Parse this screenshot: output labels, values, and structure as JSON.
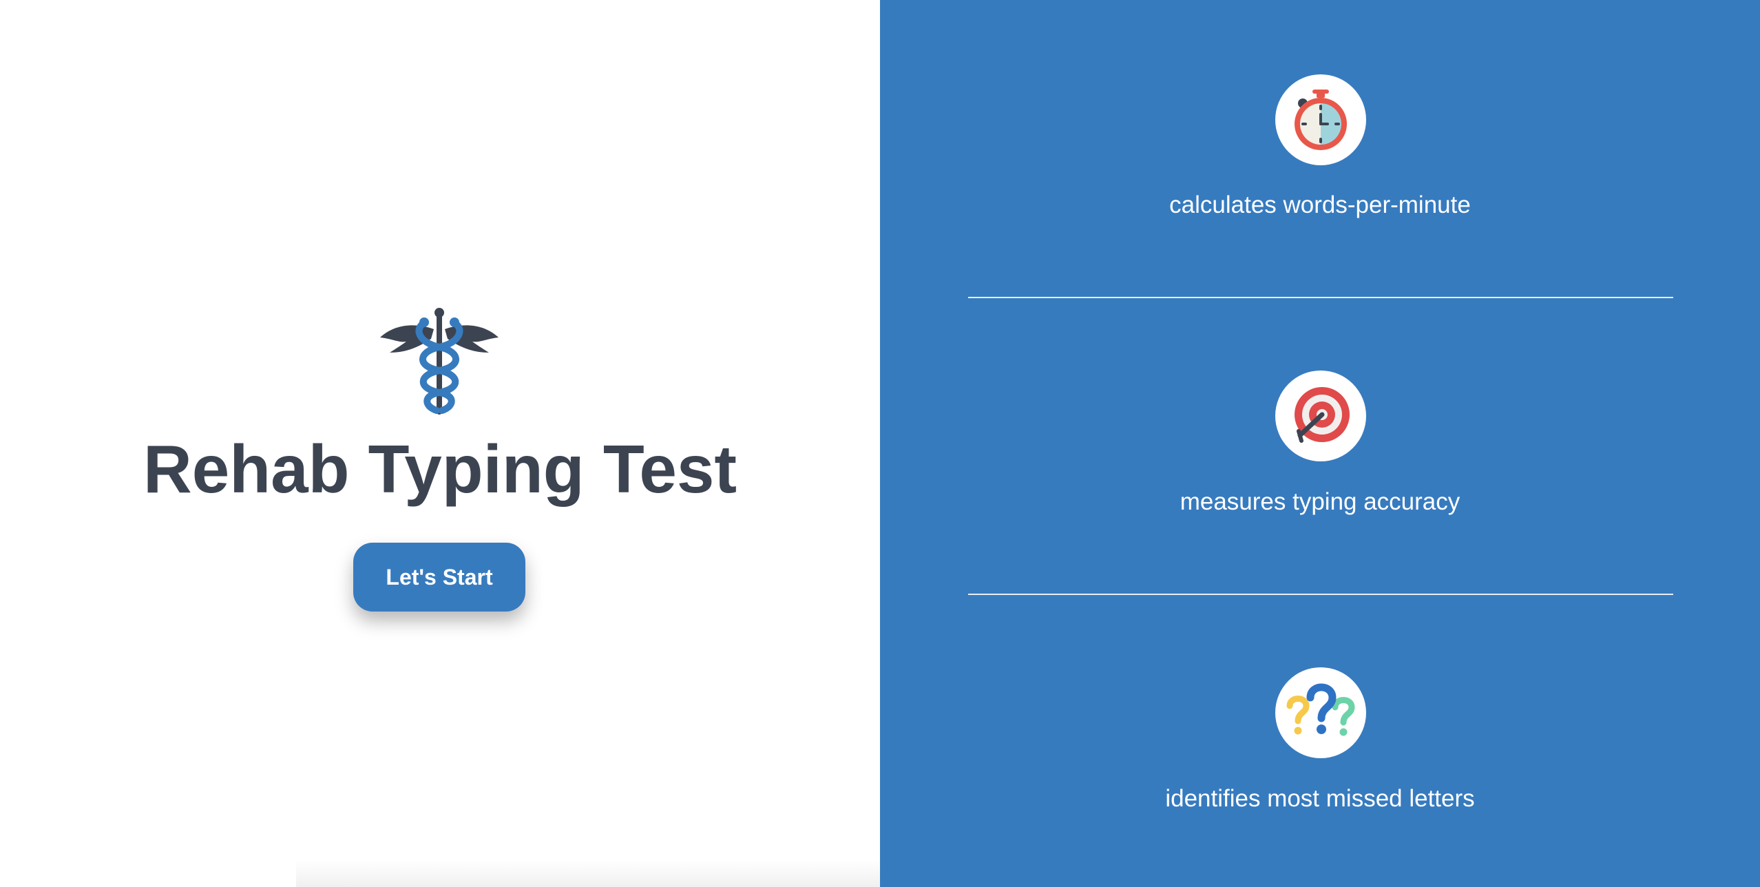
{
  "app": {
    "title": "Rehab Typing Test",
    "start_button_label": "Let's Start"
  },
  "logo": {
    "icon": "caduceus-icon"
  },
  "features": [
    {
      "icon": "stopwatch-icon",
      "label": "calculates words-per-minute"
    },
    {
      "icon": "target-icon",
      "label": "measures typing accuracy"
    },
    {
      "icon": "question-marks-icon",
      "label": "identifies most missed letters"
    }
  ],
  "colors": {
    "primary_blue": "#377bbf",
    "title_text": "#3d4451",
    "panel_text": "#ffffff"
  }
}
